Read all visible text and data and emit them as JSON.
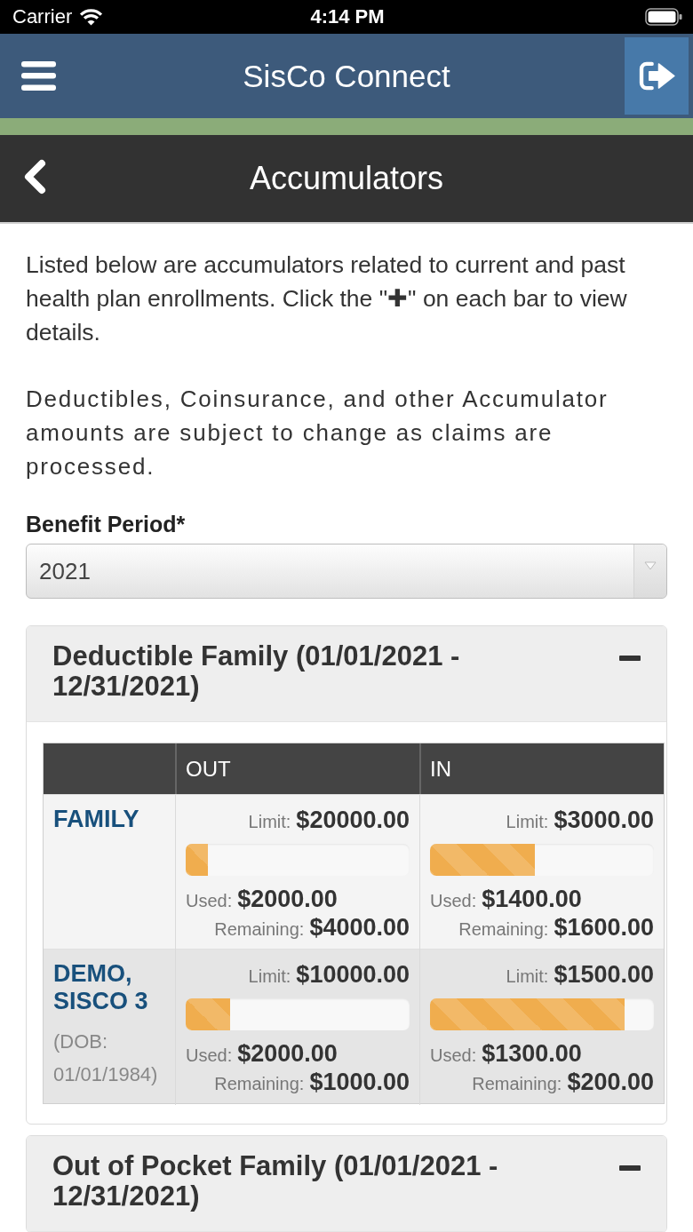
{
  "status_bar": {
    "carrier": "Carrier",
    "time": "4:14 PM"
  },
  "header": {
    "title": "SisCo Connect"
  },
  "subheader": {
    "title": "Accumulators"
  },
  "intro": [
    "Listed below are accumulators related to current and past health plan enrollments. Click the \"✚\" on each bar to view details.",
    "Deductibles, Coinsurance, and other Accumulator amounts are subject to change as claims are processed."
  ],
  "benefit_period": {
    "label": "Benefit Period*",
    "value": "2021"
  },
  "sections": [
    {
      "title": "Deductible Family (01/01/2021 - 12/31/2021)",
      "expanded": true,
      "table": {
        "columns": [
          "OUT",
          "IN"
        ],
        "rows": [
          {
            "name": "FAMILY",
            "cells": [
              {
                "limit": {
                  "label": "Limit:",
                  "value": "$20000.00"
                },
                "level": 0.1,
                "used": {
                  "label": "Used:",
                  "value": "$2000.00"
                },
                "remaining": {
                  "label": "Remaining:",
                  "value": "$4000.00"
                }
              },
              {
                "limit": {
                  "label": "Limit:",
                  "value": "$3000.00"
                },
                "level": 0.47,
                "used": {
                  "label": "Used:",
                  "value": "$1400.00"
                },
                "remaining": {
                  "label": "Remaining:",
                  "value": "$1600.00"
                }
              }
            ]
          },
          {
            "name": "DEMO, SISCO 3",
            "dob": "(DOB: 01/01/1984)",
            "cells": [
              {
                "limit": {
                  "label": "Limit:",
                  "value": "$10000.00"
                },
                "level": 0.2,
                "used": {
                  "label": "Used:",
                  "value": "$2000.00"
                },
                "remaining": {
                  "label": "Remaining:",
                  "value": "$1000.00"
                }
              },
              {
                "limit": {
                  "label": "Limit:",
                  "value": "$1500.00"
                },
                "level": 0.87,
                "used": {
                  "label": "Used:",
                  "value": "$1300.00"
                },
                "remaining": {
                  "label": "Remaining:",
                  "value": "$200.00"
                }
              }
            ]
          }
        ]
      }
    },
    {
      "title": "Out of Pocket Family (01/01/2021 - 12/31/2021)",
      "expanded": true
    }
  ]
}
